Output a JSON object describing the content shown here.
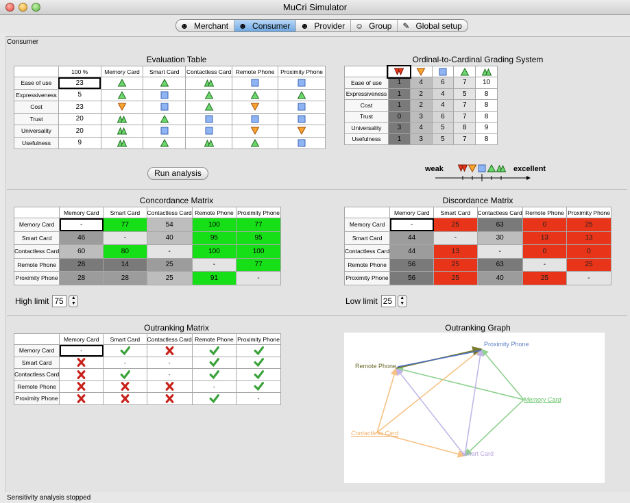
{
  "window": {
    "title": "MuCri Simulator"
  },
  "tabs": [
    {
      "label": "Merchant",
      "icon": "merchant-person-icon",
      "active": false
    },
    {
      "label": "Consumer",
      "icon": "consumer-person-icon",
      "active": true
    },
    {
      "label": "Provider",
      "icon": "provider-person-icon",
      "active": false
    },
    {
      "label": "Group",
      "icon": "group-people-icon",
      "active": false
    },
    {
      "label": "Global setup",
      "icon": "pencil-icon",
      "active": false
    }
  ],
  "panel_label": "Consumer",
  "evaluation": {
    "title": "Evaluation Table",
    "headers": [
      "",
      "100 %",
      "Memory Card",
      "Smart Card",
      "Contactless Card",
      "Remote Phone",
      "Proximity Phone"
    ],
    "rows": [
      {
        "label": "Ease of use",
        "weight": "23",
        "grades": [
          "triangle-up",
          "triangle-up",
          "double-triangle",
          "square",
          "square"
        ]
      },
      {
        "label": "Expressiveness",
        "weight": "5",
        "grades": [
          "triangle-up",
          "square",
          "triangle-up",
          "triangle-up",
          "triangle-up"
        ]
      },
      {
        "label": "Cost",
        "weight": "23",
        "grades": [
          "triangle-down",
          "square",
          "triangle-up",
          "triangle-down",
          "square"
        ]
      },
      {
        "label": "Trust",
        "weight": "20",
        "grades": [
          "double-triangle",
          "triangle-up",
          "square",
          "square",
          "square"
        ]
      },
      {
        "label": "Universality",
        "weight": "20",
        "grades": [
          "double-triangle",
          "square",
          "square",
          "triangle-down",
          "triangle-down"
        ]
      },
      {
        "label": "Usefulness",
        "weight": "9",
        "grades": [
          "double-triangle",
          "triangle-up",
          "double-triangle",
          "triangle-up",
          "square"
        ]
      }
    ]
  },
  "grading": {
    "title": "Ordinal-to-Cardinal Grading System",
    "header_icons": [
      "double-triangle-down",
      "triangle-down",
      "square",
      "triangle-up",
      "double-triangle"
    ],
    "rows": [
      {
        "label": "Ease of use",
        "values": [
          "1",
          "4",
          "6",
          "7",
          "10"
        ]
      },
      {
        "label": "Expressiveness",
        "values": [
          "1",
          "2",
          "4",
          "5",
          "8"
        ]
      },
      {
        "label": "Cost",
        "values": [
          "1",
          "2",
          "4",
          "7",
          "8"
        ]
      },
      {
        "label": "Trust",
        "values": [
          "0",
          "3",
          "6",
          "7",
          "8"
        ]
      },
      {
        "label": "Universality",
        "values": [
          "3",
          "4",
          "5",
          "8",
          "9"
        ]
      },
      {
        "label": "Usefulness",
        "values": [
          "1",
          "3",
          "5",
          "7",
          "8"
        ]
      }
    ]
  },
  "scale": {
    "weak": "weak",
    "excellent": "excellent"
  },
  "run_button": "Run analysis",
  "concordance": {
    "title": "Concordance Matrix",
    "headers": [
      "",
      "Memory Card",
      "Smart Card",
      "Contactless Card",
      "Remote Phone",
      "Proximity Phone"
    ],
    "rows": [
      {
        "label": "Memory Card",
        "cells": [
          "-",
          "77",
          "54",
          "100",
          "77"
        ],
        "tones": [
          "sel",
          "gn",
          "lg",
          "gn",
          "gn"
        ]
      },
      {
        "label": "Smart Card",
        "cells": [
          "46",
          "-",
          "40",
          "95",
          "95"
        ],
        "tones": [
          "mg",
          "gr",
          "lg",
          "gn",
          "gn"
        ]
      },
      {
        "label": "Contactless Card",
        "cells": [
          "60",
          "80",
          "-",
          "100",
          "100"
        ],
        "tones": [
          "lg",
          "gn",
          "gr",
          "gn",
          "gn"
        ]
      },
      {
        "label": "Remote Phone",
        "cells": [
          "28",
          "14",
          "25",
          "-",
          "77"
        ],
        "tones": [
          "dg",
          "dg",
          "mg",
          "gr",
          "gn"
        ]
      },
      {
        "label": "Proximity Phone",
        "cells": [
          "28",
          "28",
          "25",
          "91",
          "-"
        ],
        "tones": [
          "mg",
          "mg",
          "lg",
          "gn",
          "gr"
        ]
      }
    ]
  },
  "discordance": {
    "title": "Discordance Matrix",
    "headers": [
      "",
      "Memory Card",
      "Smart Card",
      "Contactless Card",
      "Remote Phone",
      "Proximity Phone"
    ],
    "rows": [
      {
        "label": "Memory Card",
        "cells": [
          "-",
          "25",
          "63",
          "0",
          "25"
        ],
        "tones": [
          "sel",
          "rd",
          "dg",
          "rd",
          "rd"
        ]
      },
      {
        "label": "Smart Card",
        "cells": [
          "44",
          "-",
          "30",
          "13",
          "13"
        ],
        "tones": [
          "mg",
          "gr",
          "lg",
          "rd",
          "rd"
        ]
      },
      {
        "label": "Contactless Card",
        "cells": [
          "44",
          "13",
          "-",
          "0",
          "0"
        ],
        "tones": [
          "mg",
          "rd",
          "gr",
          "rd",
          "rd"
        ]
      },
      {
        "label": "Remote Phone",
        "cells": [
          "56",
          "25",
          "63",
          "-",
          "25"
        ],
        "tones": [
          "dg",
          "rd",
          "dg",
          "gr",
          "rd"
        ]
      },
      {
        "label": "Proximity Phone",
        "cells": [
          "56",
          "25",
          "40",
          "25",
          "-"
        ],
        "tones": [
          "dg",
          "rd",
          "mg",
          "rd",
          "gr"
        ]
      }
    ]
  },
  "high_limit": {
    "label": "High limit",
    "value": "75"
  },
  "low_limit": {
    "label": "Low limit",
    "value": "25"
  },
  "outranking": {
    "title": "Outranking Matrix",
    "headers": [
      "",
      "Memory Card",
      "Smart Card",
      "Contactless Card",
      "Remote Phone",
      "Proximity Phone"
    ],
    "rows": [
      {
        "label": "Memory Card",
        "cells": [
          "-",
          "check",
          "cross",
          "check",
          "check"
        ]
      },
      {
        "label": "Smart Card",
        "cells": [
          "cross",
          "-",
          "-",
          "check",
          "check"
        ]
      },
      {
        "label": "Contactless Card",
        "cells": [
          "cross",
          "check",
          "-",
          "check",
          "check"
        ]
      },
      {
        "label": "Remote Phone",
        "cells": [
          "cross",
          "cross",
          "cross",
          "-",
          "check"
        ]
      },
      {
        "label": "Proximity Phone",
        "cells": [
          "cross",
          "cross",
          "cross",
          "check",
          "-"
        ]
      }
    ]
  },
  "graph": {
    "title": "Outranking Graph",
    "nodes": [
      {
        "label": "Proximity Phone",
        "color": "#5b7fc8"
      },
      {
        "label": "Remote Phone",
        "color": "#6b6b2e"
      },
      {
        "label": "Memory Card",
        "color": "#5fbf5f"
      },
      {
        "label": "Contactless Card",
        "color": "#f2b06a"
      },
      {
        "label": "Smart Card",
        "color": "#b7a6de"
      }
    ]
  },
  "status": "Sensitivity analysis stopped"
}
